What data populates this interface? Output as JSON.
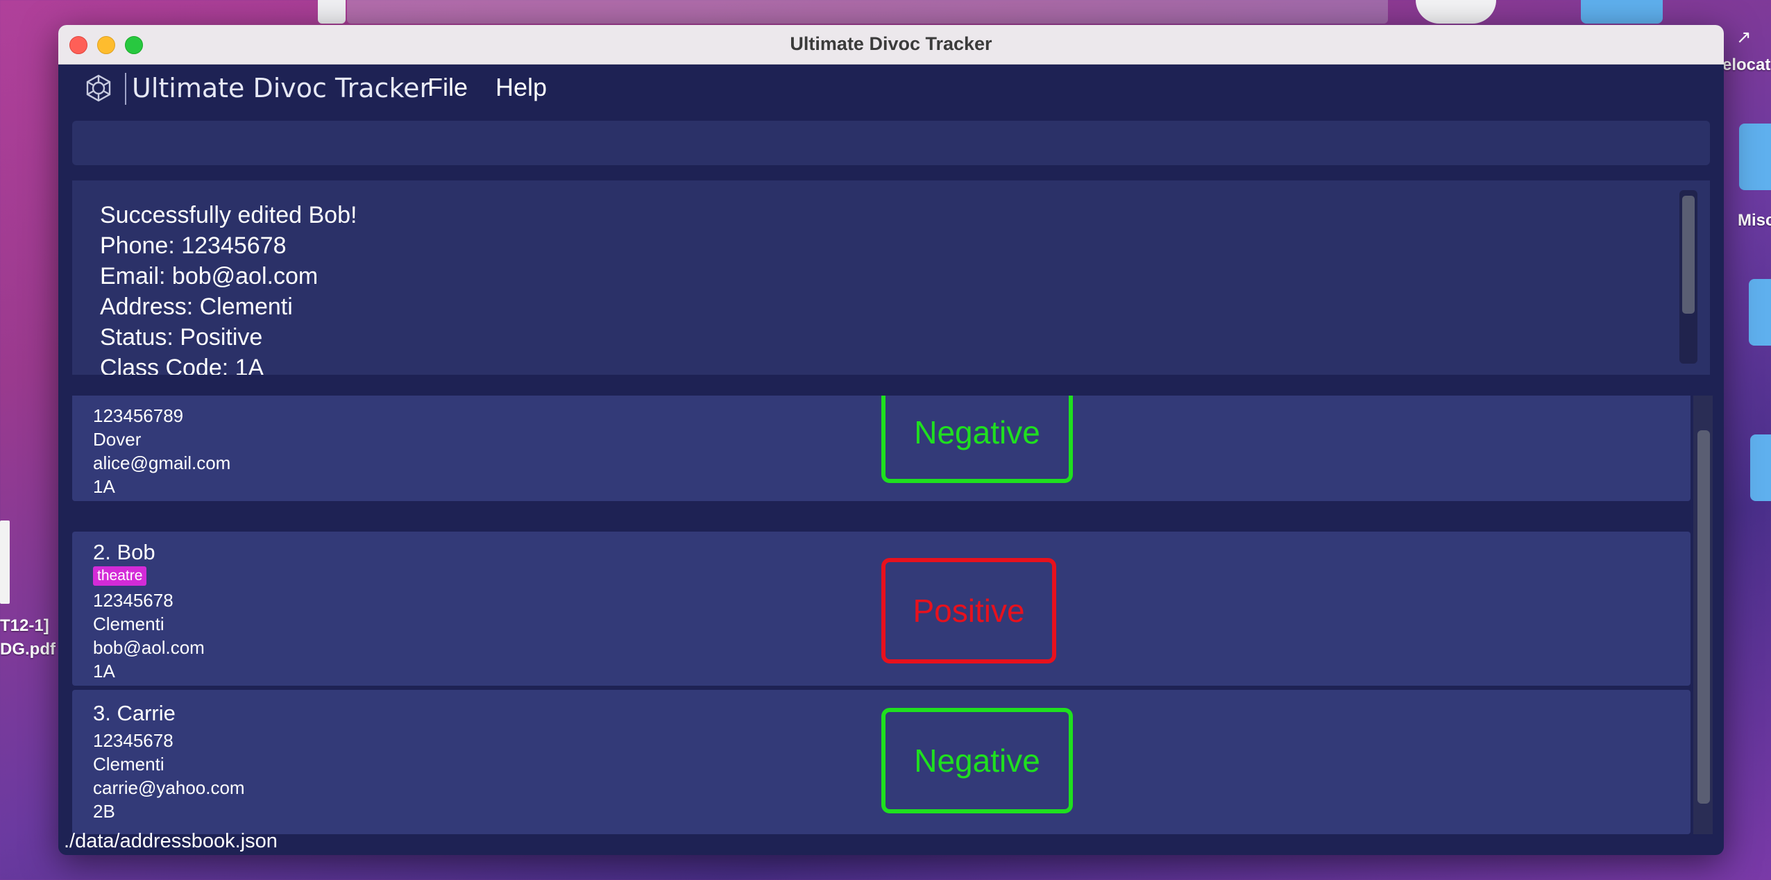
{
  "window": {
    "title": "Ultimate Divoc Tracker"
  },
  "menubar": {
    "app_name": "Ultimate Divoc Tracker",
    "menus": [
      "File",
      "Help"
    ]
  },
  "command_box": {
    "value": ""
  },
  "result": {
    "lines": [
      "Successfully edited Bob!",
      "Phone: 12345678",
      "Email: bob@aol.com",
      "Address: Clementi",
      "Status: Positive",
      "Class Code: 1A"
    ]
  },
  "persons": [
    {
      "header": "",
      "tag": "",
      "phone": "123456789",
      "address": "Dover",
      "email": "alice@gmail.com",
      "class_code": "1A",
      "status": "Negative"
    },
    {
      "header": "2.  Bob",
      "tag": "theatre",
      "phone": "12345678",
      "address": "Clementi",
      "email": "bob@aol.com",
      "class_code": "1A",
      "status": "Positive"
    },
    {
      "header": "3.  Carrie",
      "tag": "",
      "phone": "12345678",
      "address": "Clementi",
      "email": "carrie@yahoo.com",
      "class_code": "2B",
      "status": "Negative"
    }
  ],
  "status_bar": {
    "path": "./data/addressbook.json"
  },
  "desktop": {
    "file_label_line1": "T12-1]",
    "file_label_line2": "DG.pdf",
    "right_label_1": "elocat",
    "right_label_2": "Misc"
  },
  "colors": {
    "window_bg": "#1e2254",
    "panel_bg": "#2b3168",
    "card_bg": "#333a78",
    "negative": "#1fe01f",
    "positive": "#e8111d",
    "tag": "#d32bd7"
  }
}
